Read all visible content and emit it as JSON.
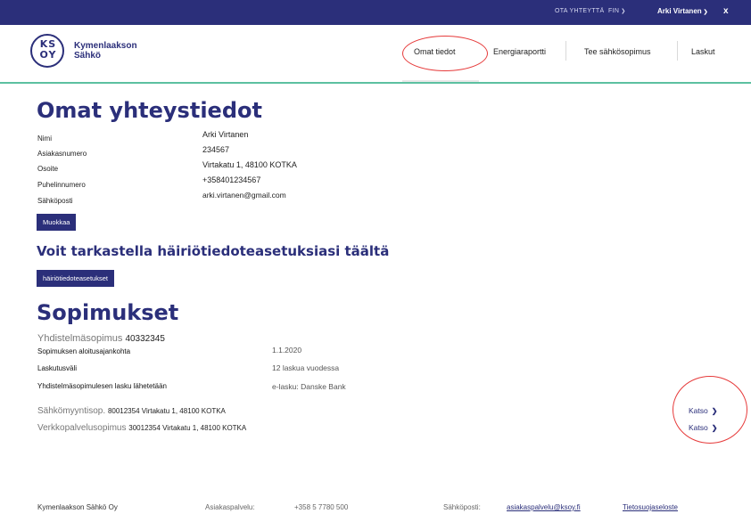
{
  "topbar": {
    "contact": "OTA YHTEYTTÄ",
    "language": "FIN",
    "user": "Arki Virtanen",
    "close": "x"
  },
  "brand": {
    "logo_letters_top": "KS",
    "logo_letters_bottom": "OY",
    "name_line1": "Kymenlaakson",
    "name_line2": "Sähkö"
  },
  "nav": {
    "items": [
      {
        "label": "Omat tiedot"
      },
      {
        "label": "Energiaraportti"
      },
      {
        "label": "Tee sähkösopimus"
      },
      {
        "label": "Laskut"
      }
    ]
  },
  "contact_section": {
    "title": "Omat yhteystiedot",
    "fields": [
      {
        "label": "Nimi",
        "value": "Arki Virtanen"
      },
      {
        "label": "Asiakasnumero",
        "value": "234567"
      },
      {
        "label": "Osoite",
        "value": "Virtakatu 1, 48100 KOTKA"
      },
      {
        "label": "Puhelinnumero",
        "value": "+358401234567"
      },
      {
        "label": "Sähköposti",
        "value": "arki.virtanen@gmail.com"
      }
    ],
    "edit_button": "Muokkaa"
  },
  "outage_section": {
    "title": "Voit tarkastella häiriötiedoteasetuksiasi täältä",
    "button": "häiriötiedoteasetukset"
  },
  "contracts_section": {
    "title": "Sopimukset",
    "combined": {
      "name": "Yhdistelmäsopimus",
      "number": "40332345",
      "rows": [
        {
          "label": "Sopimuksen aloitusajankohta",
          "value": "1.1.2020"
        },
        {
          "label": "Laskutusväli",
          "value": "12 laskua vuodessa"
        },
        {
          "label": "Yhdistelmäsopimulesen lasku lähetetään",
          "value": "e-lasku: Danske Bank"
        }
      ]
    },
    "contracts": [
      {
        "name": "Sähkömyyntisop.",
        "details": "80012354 Virtakatu 1, 48100 KOTKA",
        "action": "Katso"
      },
      {
        "name": "Verkkopalvelusopimus",
        "details": "30012354 Virtakatu 1, 48100 KOTKA",
        "action": "Katso"
      }
    ]
  },
  "footer": {
    "company": "Kymenlaakson Sähkö Oy",
    "service_label": "Asiakaspalvelu:",
    "service_phone": "+358 5 7780 500",
    "email_label": "Sähköposti:",
    "email": "asiakaspalvelu@ksoy.fi",
    "privacy": "Tietosuojaseloste"
  },
  "colors": {
    "brand": "#2b2f7a",
    "accent_line": "#5cc0a0",
    "annotation": "#e63a3a"
  }
}
